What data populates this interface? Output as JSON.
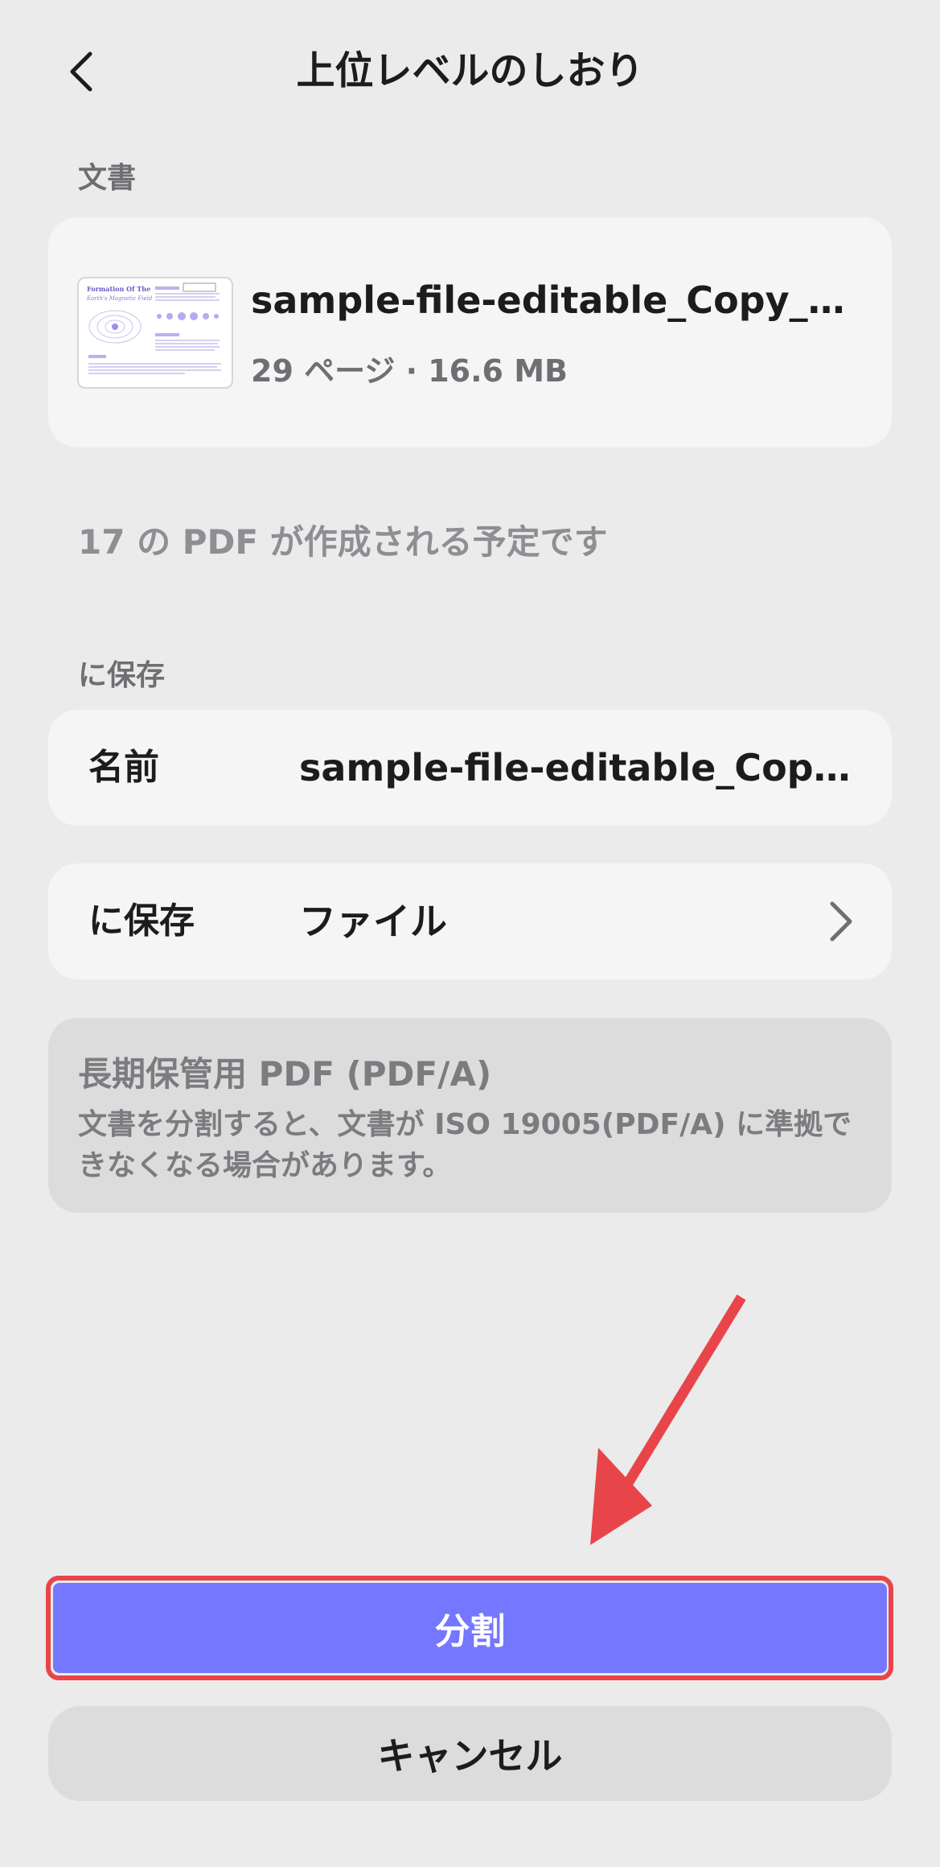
{
  "header": {
    "title": "上位レベルのしおり",
    "back_icon": "chevron-left-icon"
  },
  "document_section": {
    "label": "文書",
    "file_name": "sample-file-editable_Copy_Co...",
    "meta": "29 ページ · 16.6 MB",
    "thumbnail": {
      "title_line1": "Formation Of The",
      "title_line2": "Earth's Magnetic Field"
    }
  },
  "notice": "17 の PDF が作成される予定です",
  "save_section": {
    "label": "に保存",
    "name_row": {
      "key": "名前",
      "value": "sample-file-editable_Copy_..."
    },
    "location_row": {
      "key": "に保存",
      "value": "ファイル",
      "icon": "chevron-right-icon"
    }
  },
  "pdfa_info": {
    "title": "長期保管用 PDF (PDF/A)",
    "description": "文書を分割すると、文書が ISO 19005(PDF/A) に準拠できなくなる場合があります。"
  },
  "actions": {
    "split_label": "分割",
    "cancel_label": "キャンセル"
  },
  "colors": {
    "background": "#ebebeb",
    "card": "#f5f5f5",
    "accent": "#7577ff",
    "annotation": "#e8454a"
  }
}
